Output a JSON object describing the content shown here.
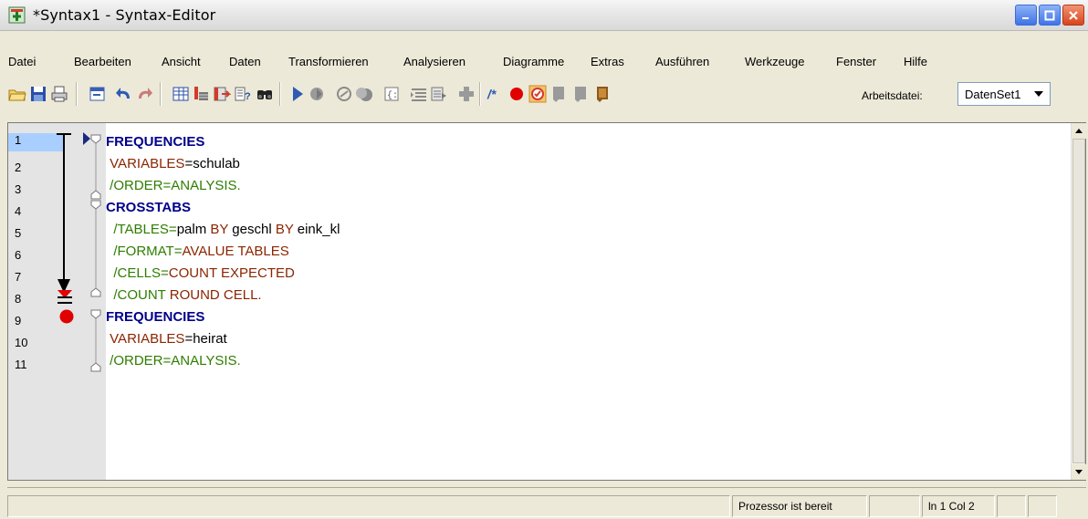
{
  "window": {
    "title": "*Syntax1 - Syntax-Editor"
  },
  "menu": [
    {
      "label": "Datei"
    },
    {
      "label": "Bearbeiten"
    },
    {
      "label": "Ansicht"
    },
    {
      "label": "Daten"
    },
    {
      "label": "Transformieren"
    },
    {
      "label": "Analysieren"
    },
    {
      "label": "Diagramme"
    },
    {
      "label": "Extras"
    },
    {
      "label": "Ausführen"
    },
    {
      "label": "Werkzeuge"
    },
    {
      "label": "Fenster"
    },
    {
      "label": "Hilfe"
    }
  ],
  "toolbar": {
    "icons": [
      "open-folder-icon",
      "save-icon",
      "print-icon",
      "dialog-recall-icon",
      "undo-icon",
      "redo-icon",
      "goto-case-icon",
      "goto-variable-icon",
      "variables-icon",
      "use-sets-icon",
      "find-icon",
      "run-selection-icon",
      "stop-icon",
      "toggle-breakpoint-icon",
      "clear-breakpoints-icon",
      "step-icon",
      "indent-icon",
      "outdent-icon",
      "add-icon",
      "comment-icon",
      "breakpoint-icon",
      "validate-icon",
      "bookmark-icon",
      "bookmark-next-icon",
      "bookmark-prev-icon"
    ],
    "active_dataset_label": "Arbeitsdatei:",
    "active_dataset_value": "DatenSet1"
  },
  "editor": {
    "line_numbers": [
      "1",
      "2",
      "3",
      "4",
      "5",
      "6",
      "7",
      "8",
      "9",
      "10",
      "11"
    ],
    "lines": [
      {
        "segments": [
          {
            "t": "FREQUENCIES",
            "c": "kw"
          }
        ]
      },
      {
        "segments": [
          {
            "t": " VARIABLES",
            "c": "sub"
          },
          {
            "t": "=schulab",
            "c": "plain"
          }
        ]
      },
      {
        "segments": [
          {
            "t": " /ORDER=ANALYSIS.",
            "c": "eq"
          }
        ]
      },
      {
        "segments": [
          {
            "t": "CROSSTABS",
            "c": "kw"
          }
        ]
      },
      {
        "segments": [
          {
            "t": "  /TABLES=",
            "c": "eq"
          },
          {
            "t": "palm ",
            "c": "plain"
          },
          {
            "t": "BY",
            "c": "by"
          },
          {
            "t": " geschl ",
            "c": "plain"
          },
          {
            "t": "BY",
            "c": "by"
          },
          {
            "t": " eink_kl",
            "c": "plain"
          }
        ]
      },
      {
        "segments": [
          {
            "t": "  /FORMAT=",
            "c": "eq"
          },
          {
            "t": "AVALUE TABLES",
            "c": "opt"
          }
        ]
      },
      {
        "segments": [
          {
            "t": "  /CELLS=",
            "c": "eq"
          },
          {
            "t": "COUNT EXPECTED",
            "c": "opt"
          }
        ]
      },
      {
        "segments": [
          {
            "t": "  /COUNT ",
            "c": "eq"
          },
          {
            "t": "ROUND CELL.",
            "c": "opt"
          }
        ]
      },
      {
        "segments": [
          {
            "t": "FREQUENCIES",
            "c": "kw"
          }
        ]
      },
      {
        "segments": [
          {
            "t": " VARIABLES",
            "c": "sub"
          },
          {
            "t": "=heirat",
            "c": "plain"
          }
        ]
      },
      {
        "segments": [
          {
            "t": " /ORDER=ANALYSIS.",
            "c": "eq"
          }
        ]
      }
    ]
  },
  "status": {
    "processor": "Prozessor ist bereit",
    "position": "ln 1 Col 2"
  }
}
